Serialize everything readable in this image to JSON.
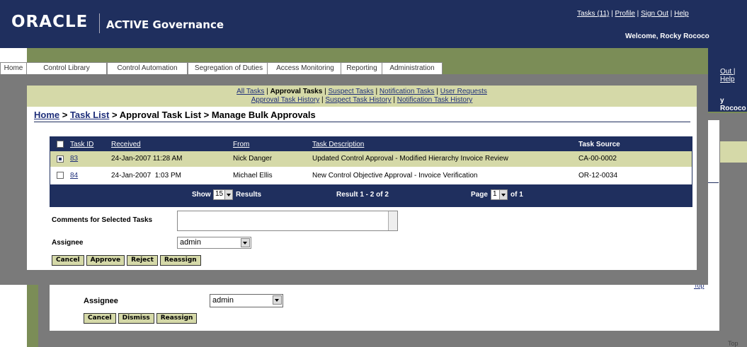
{
  "header": {
    "logo": "ORACLE",
    "app_name": "ACTIVE Governance",
    "links": [
      "Tasks (11)",
      "Profile",
      "Sign Out",
      "Help"
    ],
    "welcome": "Welcome, Rocky Rococo"
  },
  "tabs": [
    "Home",
    "Control Library",
    "Control Automation",
    "Segregation of Duties",
    "Access Monitoring",
    "Reporting",
    "Administration"
  ],
  "subnav": {
    "row1": [
      "All Tasks",
      "Approval Tasks",
      "Suspect Tasks",
      "Notification Tasks",
      "User Requests"
    ],
    "row2": [
      "Approval Task History",
      "Suspect Task History",
      "Notification Task History"
    ],
    "current": "Approval Tasks"
  },
  "breadcrumb": {
    "home": "Home",
    "task_list": "Task List",
    "rest": "Approval Task List > Manage Bulk Approvals"
  },
  "table": {
    "columns": [
      "Task ID",
      "Received",
      "From",
      "Task Description",
      "Task Source"
    ],
    "rows": [
      {
        "task_id": "83",
        "received": "24-Jan-2007 11:28 AM",
        "from": "Nick Danger",
        "description": "Updated Control Approval - Modified Hierarchy Invoice Review",
        "source": "CA-00-0002",
        "checked": true
      },
      {
        "task_id": "84",
        "received": "24-Jan-2007  1:03 PM",
        "from": "Michael Ellis",
        "description": "New Control Objective Approval - Invoice Verification",
        "source": "OR-12-0034",
        "checked": false
      }
    ],
    "footer": {
      "show_label": "Show",
      "page_size": "15",
      "results_label": "Results",
      "result_text": "Result 1 - 2 of 2",
      "page_label": "Page",
      "page_value": "1",
      "of_label": "of 1"
    }
  },
  "form": {
    "comments_label": "Comments for Selected Tasks",
    "assignee_label": "Assignee",
    "assignee_value": "admin",
    "buttons": [
      "Cancel",
      "Approve",
      "Reject",
      "Reassign"
    ]
  },
  "background_window": {
    "links_fragment": "Out | Help",
    "welcome_fragment": "y Rococo",
    "assignee_label": "Assignee",
    "assignee_value": "admin",
    "buttons": [
      "Cancel",
      "Dismiss",
      "Reassign"
    ],
    "top_link": "Top"
  },
  "colors": {
    "navy": "#1f2f5e",
    "olive": "#7b8d57",
    "khaki": "#d5d9a8",
    "gray": "#7a7a7a"
  }
}
